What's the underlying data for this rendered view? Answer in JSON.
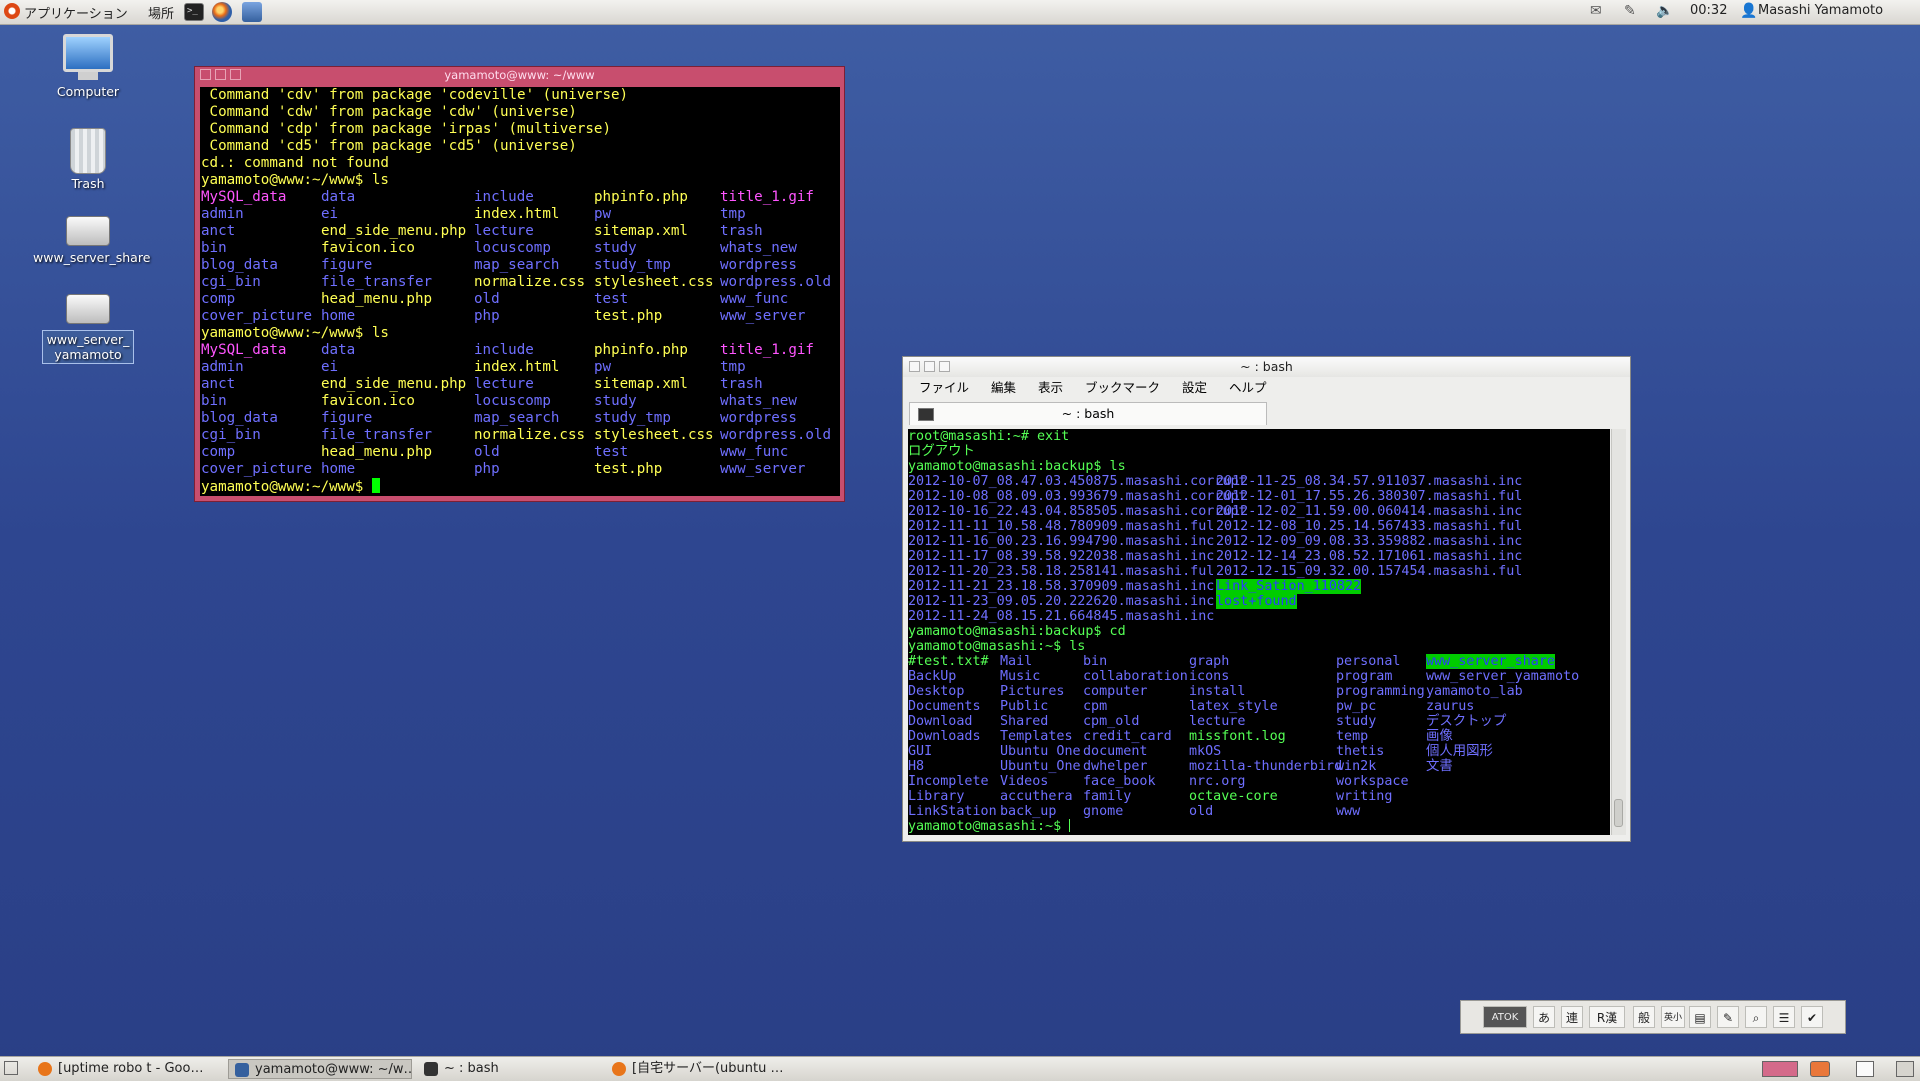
{
  "top_panel": {
    "applications": "アプリケーション",
    "places": "場所",
    "time": "00:32",
    "user": "Masashi Yamamoto",
    "icons": [
      "ubuntu-logo-icon",
      "terminal-launcher-icon",
      "firefox-launcher-icon",
      "network-launcher-icon",
      "mail-icon",
      "chat-icon",
      "volume-icon",
      "user-icon"
    ]
  },
  "desktop_icons": [
    {
      "label": "Computer",
      "icon": "computer-icon"
    },
    {
      "label": "Trash",
      "icon": "trash-icon"
    },
    {
      "label": "www_server_share",
      "icon": "drive-icon"
    },
    {
      "label_line1": "www_server_",
      "label_line2": "yamamoto",
      "icon": "drive-icon"
    }
  ],
  "terminal1": {
    "title": "yamamoto@www: ~/www",
    "pre_lines": [
      "Command 'cdv' from package 'codeville' (universe)",
      "Command 'cdw' from package 'cdw' (universe)",
      "Command 'cdp' from package 'irpas' (multiverse)",
      "Command 'cd5' from package 'cd5' (universe)",
      "cd.: command not found"
    ],
    "prompt": "yamamoto@www:~/www$ ",
    "command": "ls",
    "ls_columns": [
      [
        "MySQL_data",
        "admin",
        "anct",
        "bin",
        "blog_data",
        "cgi_bin",
        "comp",
        "cover_picture"
      ],
      [
        "data",
        "ei",
        "end_side_menu.php",
        "favicon.ico",
        "figure",
        "file_transfer",
        "head_menu.php",
        "home"
      ],
      [
        "include",
        "index.html",
        "lecture",
        "locuscomp",
        "map_search",
        "normalize.css",
        "old",
        "php"
      ],
      [
        "phpinfo.php",
        "pw",
        "sitemap.xml",
        "study",
        "study_tmp",
        "stylesheet.css",
        "test",
        "test.php"
      ],
      [
        "title_1.gif",
        "tmp",
        "trash",
        "whats_new",
        "wordpress",
        "wordpress.old",
        "www_func",
        "www_server"
      ]
    ],
    "ls_colors": [
      [
        "m",
        "b",
        "b",
        "b",
        "b",
        "b",
        "b",
        "b"
      ],
      [
        "b",
        "b",
        "y",
        "y",
        "b",
        "b",
        "y",
        "b"
      ],
      [
        "b",
        "y",
        "b",
        "b",
        "b",
        "y",
        "b",
        "b"
      ],
      [
        "y",
        "b",
        "y",
        "b",
        "b",
        "y",
        "b",
        "y"
      ],
      [
        "m",
        "b",
        "b",
        "b",
        "b",
        "b",
        "b",
        "b"
      ]
    ]
  },
  "terminal2": {
    "title": "~ : bash",
    "menu": [
      "ファイル",
      "編集",
      "表示",
      "ブックマーク",
      "設定",
      "ヘルプ"
    ],
    "tab_label": "~ : bash",
    "line1": "root@masashi:~# exit",
    "line2": "ログアウト",
    "line3": "yamamoto@masashi:backup$ ls",
    "backup_col1": [
      "2012-10-07_08.47.03.450875.masashi.corrupt",
      "2012-10-08_08.09.03.993679.masashi.corrupt",
      "2012-10-16_22.43.04.858505.masashi.corrupt",
      "2012-11-11_10.58.48.780909.masashi.ful",
      "2012-11-16_00.23.16.994790.masashi.inc",
      "2012-11-17_08.39.58.922038.masashi.inc",
      "2012-11-20_23.58.18.258141.masashi.ful",
      "2012-11-21_23.18.58.370909.masashi.inc",
      "2012-11-23_09.05.20.222620.masashi.inc",
      "2012-11-24_08.15.21.664845.masashi.inc"
    ],
    "backup_col2": [
      "2012-11-25_08.34.57.911037.masashi.inc",
      "2012-12-01_17.55.26.380307.masashi.ful",
      "2012-12-02_11.59.00.060414.masashi.inc",
      "2012-12-08_10.25.14.567433.masashi.ful",
      "2012-12-09_09.08.33.359882.masashi.inc",
      "2012-12-14_23.08.52.171061.masashi.inc",
      "2012-12-15_09.32.00.157454.masashi.ful",
      "Link_Sation_110822",
      "lost+found"
    ],
    "line_cd": "yamamoto@masashi:backup$ cd",
    "line_ls": "yamamoto@masashi:~$ ls",
    "home_columns": [
      [
        "#test.txt#",
        "BackUp",
        "Desktop",
        "Documents",
        "Download",
        "Downloads",
        "GUI",
        "H8",
        "Incomplete",
        "Library",
        "LinkStation"
      ],
      [
        "Mail",
        "Music",
        "Pictures",
        "Public",
        "Shared",
        "Templates",
        "Ubuntu One",
        "Ubuntu_One",
        "Videos",
        "accuthera",
        "back_up"
      ],
      [
        "bin",
        "collaboration",
        "computer",
        "cpm",
        "cpm_old",
        "credit_card",
        "document",
        "dwhelper",
        "face_book",
        "family",
        "gnome"
      ],
      [
        "graph",
        "icons",
        "install",
        "latex_style",
        "lecture",
        "missfont.log",
        "mkOS",
        "mozilla-thunderbird",
        "nrc.org",
        "octave-core",
        "old"
      ],
      [
        "personal",
        "program",
        "programming",
        "pw_pc",
        "study",
        "temp",
        "thetis",
        "win2k",
        "workspace",
        "writing",
        "www"
      ],
      [
        "www_server_share",
        "www_server_yamamoto",
        "yamamoto_lab",
        "zaurus",
        "デスクトップ",
        "画像",
        "個人用図形",
        "文書"
      ]
    ],
    "final_prompt": "yamamoto@masashi:~$ "
  },
  "atok": {
    "logo": "ATOK",
    "buttons": [
      "あ",
      "連",
      "R漢",
      "般",
      "英小"
    ]
  },
  "taskbar": [
    {
      "label": "[uptime robo t - Goo…",
      "icon": "firefox-icon",
      "active": false
    },
    {
      "label": "yamamoto@www: ~/w…",
      "icon": "terminal-icon",
      "active": true
    },
    {
      "label": "~ : bash",
      "icon": "terminal-icon",
      "active": false
    },
    {
      "label": "[自宅サーバー(ubuntu …",
      "icon": "firefox-icon",
      "active": false
    }
  ]
}
